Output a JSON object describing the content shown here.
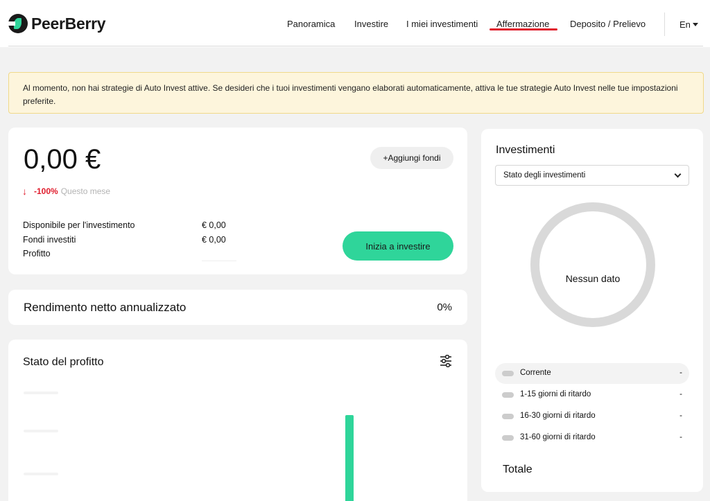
{
  "header": {
    "brand": "PeerBerry",
    "nav": [
      {
        "label": "Panoramica"
      },
      {
        "label": "Investire"
      },
      {
        "label": "I miei investimenti"
      },
      {
        "label": "Affermazione"
      },
      {
        "label": "Deposito / Prelievo"
      }
    ],
    "language": "En"
  },
  "banner": {
    "text": "Al momento, non hai strategie di Auto Invest attive. Se desideri che i tuoi investimenti vengano elaborati automaticamente, attiva le tue strategie Auto Invest nelle tue impostazioni preferite."
  },
  "account": {
    "balance": "0,00 €",
    "add_funds_label": "+Aggiungi fondi",
    "change_pct": "-100%",
    "change_label": "Questo mese",
    "rows": [
      {
        "label": "Disponibile per l'investimento",
        "value": "€ 0,00"
      },
      {
        "label": "Fondi investiti",
        "value": "€ 0,00"
      },
      {
        "label": "Profitto",
        "value": ""
      }
    ],
    "cta_label": "Inizia a investire"
  },
  "yield": {
    "label": "Rendimento netto annualizzato",
    "value": "0%"
  },
  "profit": {
    "title": "Stato del profitto"
  },
  "investments": {
    "title": "Investimenti",
    "select_value": "Stato degli investimenti",
    "donut_label": "Nessun dato",
    "legend": [
      {
        "label": "Corrente",
        "value": "-"
      },
      {
        "label": "1-15 giorni di ritardo",
        "value": "-"
      },
      {
        "label": "16-30 giorni di ritardo",
        "value": "-"
      },
      {
        "label": "31-60 giorni di ritardo",
        "value": "-"
      }
    ],
    "total_label": "Totale"
  },
  "colors": {
    "accent": "#2fd59a",
    "negative": "#e01c2c",
    "banner_bg": "#fdf5dc",
    "page_bg": "#f2f2f2"
  }
}
